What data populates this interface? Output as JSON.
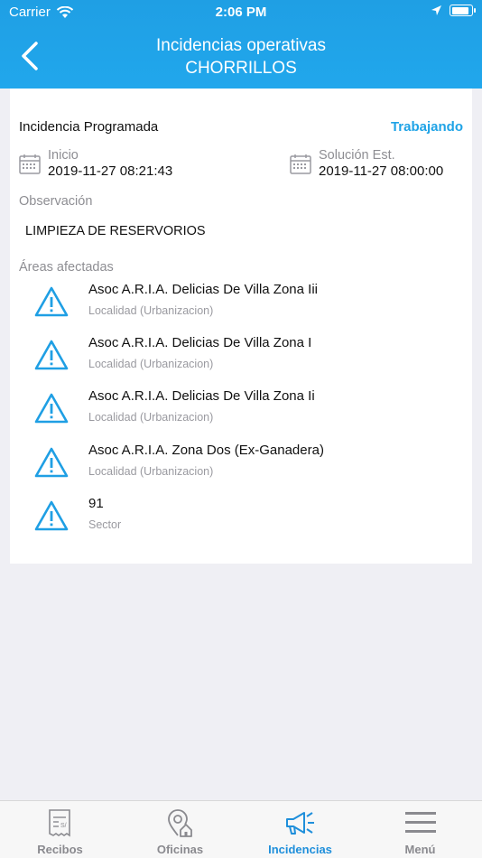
{
  "status_bar": {
    "carrier": "Carrier",
    "time": "2:06 PM"
  },
  "header": {
    "title_line1": "Incidencias operativas",
    "title_line2": "CHORRILLOS"
  },
  "incident": {
    "type": "Incidencia Programada",
    "status": "Trabajando",
    "inicio_label": "Inicio",
    "inicio_value": "2019-11-27 08:21:43",
    "solucion_label": "Solución Est.",
    "solucion_value": "2019-11-27 08:00:00",
    "observacion_label": "Observación",
    "observacion_value": "LIMPIEZA DE RESERVORIOS",
    "areas_label": "Áreas afectadas",
    "areas": [
      {
        "name": "Asoc A.R.I.A. Delicias De Villa Zona Iii",
        "kind": "Localidad (Urbanizacion)"
      },
      {
        "name": "Asoc A.R.I.A. Delicias De Villa Zona I",
        "kind": "Localidad (Urbanizacion)"
      },
      {
        "name": "Asoc A.R.I.A. Delicias De Villa Zona Ii",
        "kind": "Localidad (Urbanizacion)"
      },
      {
        "name": "Asoc A.R.I.A. Zona Dos (Ex-Ganadera)",
        "kind": "Localidad (Urbanizacion)"
      },
      {
        "name": "91",
        "kind": "Sector"
      }
    ]
  },
  "tabbar": {
    "items": [
      {
        "label": "Recibos",
        "icon": "receipt-icon"
      },
      {
        "label": "Oficinas",
        "icon": "office-location-icon"
      },
      {
        "label": "Incidencias",
        "icon": "megaphone-icon",
        "active": true
      },
      {
        "label": "Menú",
        "icon": "menu-icon"
      }
    ],
    "receipt_icon_text": "S/"
  },
  "colors": {
    "accent": "#1fa3e6",
    "header": "#21a7ec",
    "warning": "#1f9fe4"
  }
}
